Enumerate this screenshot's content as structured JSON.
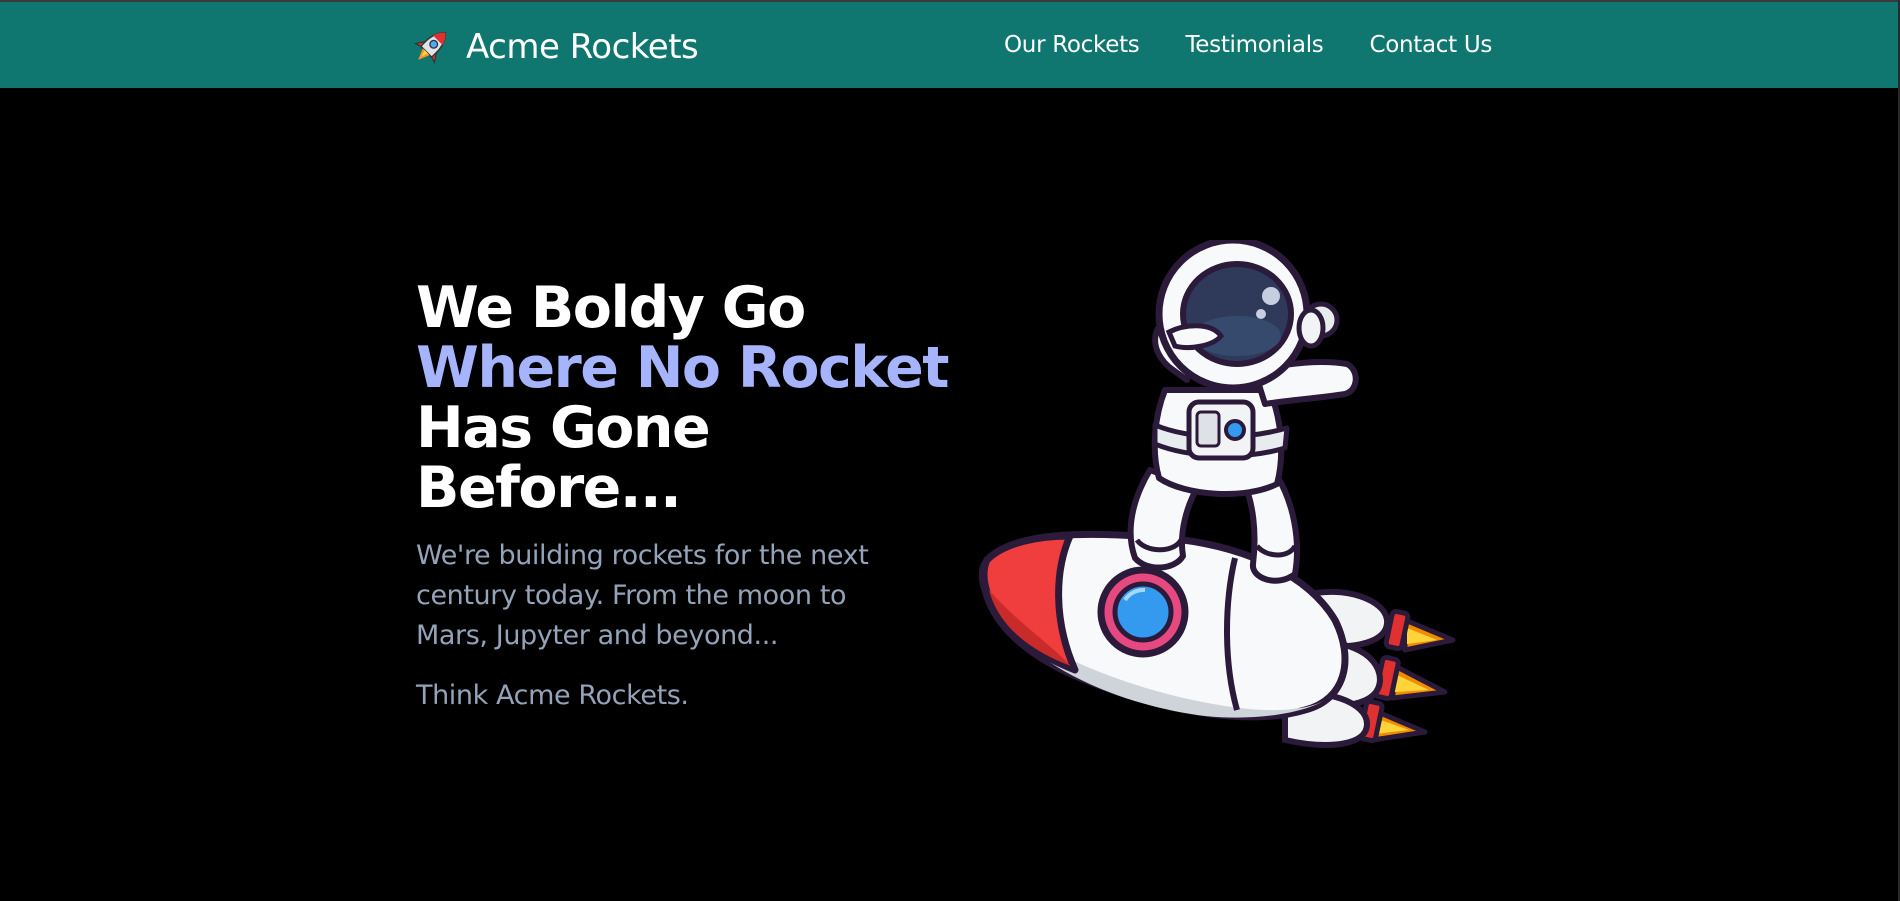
{
  "brand": {
    "name": "Acme Rockets",
    "icon": "rocket-icon"
  },
  "nav": {
    "links": [
      {
        "label": "Our Rockets"
      },
      {
        "label": "Testimonials"
      },
      {
        "label": "Contact Us"
      }
    ]
  },
  "hero": {
    "headline_line1": "We Boldy Go",
    "headline_line2": "Where No Rocket",
    "headline_line3": "Has Gone",
    "headline_line4": "Before...",
    "lead": "We're building rockets for the next century today. From the moon to Mars, Jupyter and beyond...",
    "tagline": "Think Acme Rockets.",
    "illustration": "astronaut-on-rocket-illustration"
  },
  "colors": {
    "navbar": "#107770",
    "background": "#000000",
    "accent": "#a5b4fc",
    "body_text": "#94a3b8"
  }
}
